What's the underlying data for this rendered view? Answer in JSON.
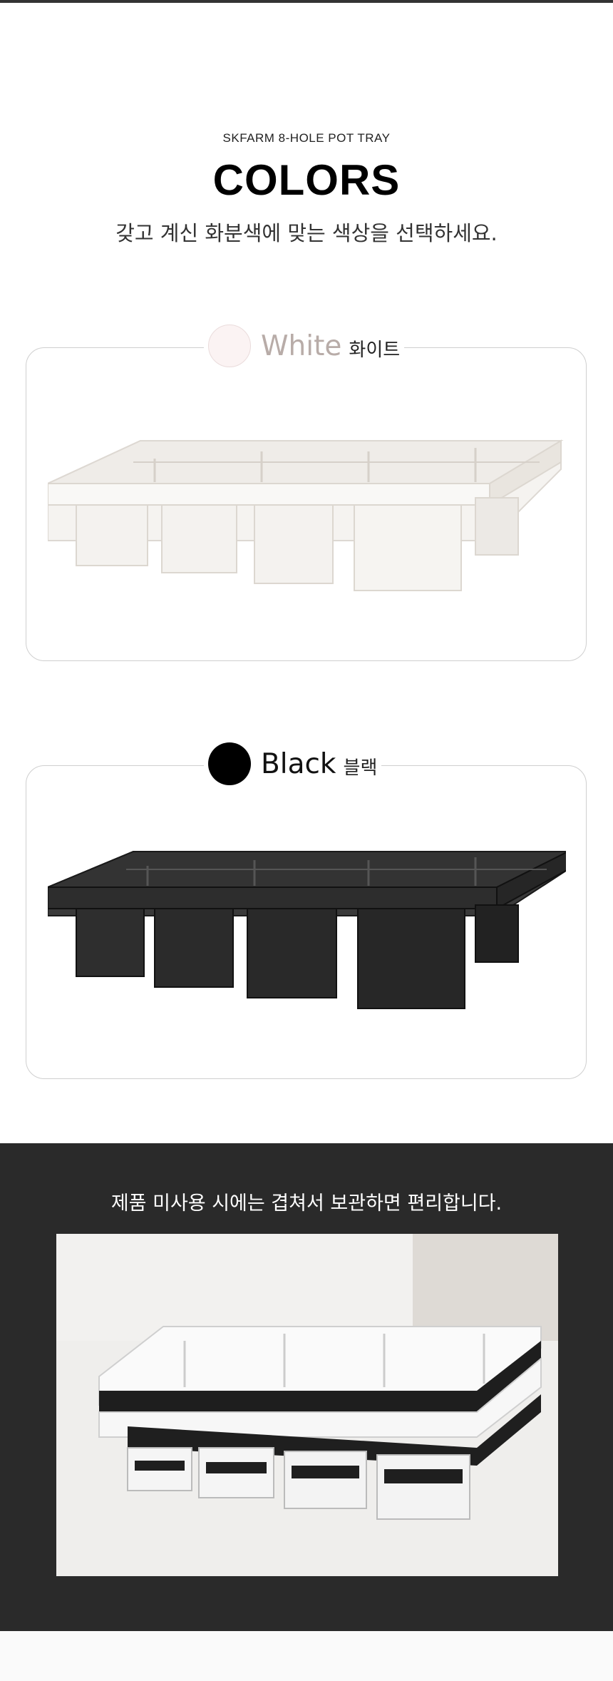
{
  "header": {
    "subtitle": "SKFARM 8-HOLE POT TRAY",
    "title": "COLORS",
    "description": "갖고 계신 화분색에 맞는 색상을 선택하세요."
  },
  "colors": [
    {
      "name_en": "White",
      "name_ko": "화이트",
      "swatch_color": "#fbf3f3",
      "tray_color": "#f3f1ee"
    },
    {
      "name_en": "Black",
      "name_ko": "블랙",
      "swatch_color": "#000000",
      "tray_color": "#2b2b2b"
    }
  ],
  "storage": {
    "caption": "제품  미사용 시에는 겹쳐서 보관하면 편리합니다."
  }
}
